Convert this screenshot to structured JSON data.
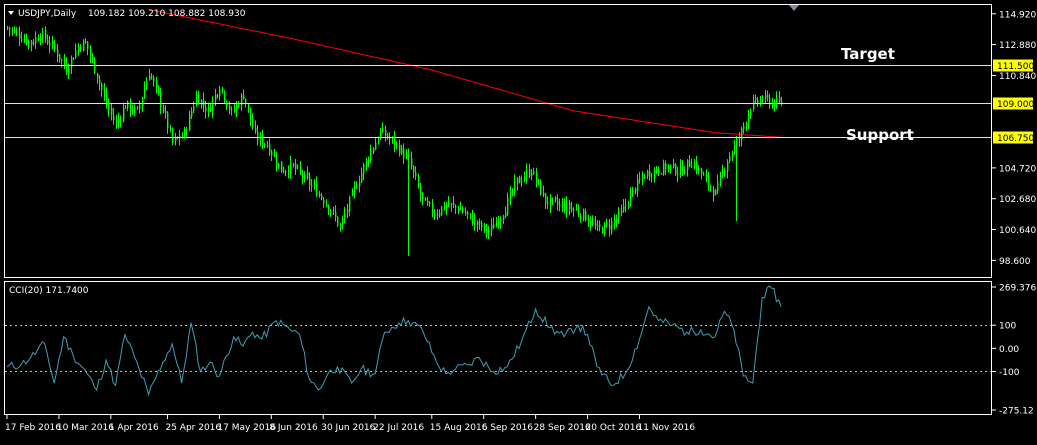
{
  "chart_data": [
    {
      "type": "candlestick",
      "title": "USDJPY,Daily",
      "ohlc_readout": "109.182 109.210 108.882 108.930",
      "ylim": [
        97.5,
        115.5
      ],
      "price_ticks": [
        "114.920",
        "112.880",
        "110.840",
        "104.720",
        "102.680",
        "100.640",
        "98.600"
      ],
      "price_tick_values": [
        114.92,
        112.88,
        110.84,
        104.72,
        102.68,
        100.64,
        98.6
      ],
      "levels": [
        {
          "value": 111.5,
          "label": "111.500",
          "annotation": "Target",
          "color": "#ffff00"
        },
        {
          "value": 109.0,
          "label": "109.000",
          "annotation": "",
          "color": "#ffff00"
        },
        {
          "value": 106.75,
          "label": "106.750",
          "annotation": "Support",
          "color": "#ffff00"
        }
      ],
      "series_color": "#00ff00",
      "ma_color": "#ff0000",
      "ohlc_anchor_days": [
        0,
        4,
        8,
        12,
        16,
        20,
        24,
        27,
        30,
        33,
        36,
        40,
        44,
        48,
        52,
        56,
        60,
        64,
        68,
        72,
        76,
        80,
        84,
        88,
        92,
        96,
        100,
        104,
        108,
        112,
        116,
        120,
        124,
        128,
        132,
        136,
        140,
        144,
        148,
        152,
        156,
        160,
        164,
        168,
        172,
        176,
        180,
        184,
        188,
        192,
        196,
        200,
        204,
        208,
        212,
        216,
        220,
        224,
        228,
        232,
        236,
        240,
        244,
        248,
        252,
        256,
        260,
        264,
        268,
        272,
        274
      ],
      "close_anchors": [
        114.0,
        113.5,
        113.0,
        113.6,
        112.8,
        111.3,
        112.8,
        113.0,
        111.3,
        108.9,
        107.6,
        108.9,
        108.4,
        111.1,
        108.6,
        106.4,
        107.0,
        109.5,
        108.5,
        110.2,
        108.3,
        109.6,
        106.8,
        106.3,
        104.6,
        104.8,
        104.0,
        103.2,
        102.2,
        100.8,
        103.7,
        105.5,
        107.1,
        106.4,
        105.2,
        102.5,
        101.7,
        102.3,
        102.0,
        101.1,
        100.5,
        101.8,
        103.8,
        104.6,
        102.5,
        102.2,
        102.0,
        101.5,
        100.6,
        100.9,
        101.7,
        103.2,
        104.3,
        104.6,
        104.8,
        104.5,
        105.2,
        104.1,
        103.0,
        105.3,
        106.7,
        108.8,
        109.3,
        109.0,
        108.93
      ],
      "close_anchor_days": [
        0,
        5,
        10,
        14,
        19,
        25,
        30,
        33,
        37,
        42,
        46,
        50,
        55,
        60,
        66,
        70,
        75,
        80,
        85,
        90,
        95,
        100,
        105,
        110,
        116,
        121,
        126,
        131,
        136,
        141,
        148,
        153,
        158,
        164,
        170,
        176,
        181,
        186,
        192,
        198,
        204,
        210,
        216,
        222,
        228,
        234,
        240,
        245,
        250,
        255,
        260,
        265,
        270,
        275,
        280,
        285,
        290,
        295,
        300,
        305,
        310,
        315,
        320,
        325,
        328
      ],
      "ma200_anchors": [
        {
          "day": 60,
          "value": 115.2
        },
        {
          "day": 120,
          "value": 113.3
        },
        {
          "day": 180,
          "value": 111.2
        },
        {
          "day": 240,
          "value": 108.5
        },
        {
          "day": 300,
          "value": 107.05
        },
        {
          "day": 328,
          "value": 106.75
        }
      ],
      "low_spikes": [
        {
          "day": 170,
          "value": 98.9
        },
        {
          "day": 309,
          "value": 101.2
        }
      ]
    },
    {
      "type": "line",
      "title": "CCI(20) 171.7400",
      "ylim": [
        -275.12,
        269.38
      ],
      "ticks": [
        "269.3767",
        "100",
        "0.00",
        "-100",
        "-275.12"
      ],
      "tick_values": [
        269.3767,
        100,
        0,
        -100,
        -275.12
      ],
      "dashed_levels": [
        100,
        -100
      ],
      "line_color": "#3ea0b4",
      "x_days": [
        0,
        6,
        10,
        16,
        20,
        24,
        28,
        34,
        38,
        42,
        46,
        50,
        56,
        60,
        66,
        70,
        74,
        78,
        82,
        86,
        90,
        96,
        100,
        104,
        108,
        114,
        120,
        124,
        128,
        132,
        136,
        140,
        146,
        150,
        156,
        160,
        166,
        170,
        176,
        182,
        186,
        190,
        196,
        200,
        206,
        212,
        218,
        224,
        230,
        236,
        242,
        246,
        250,
        256,
        262,
        268,
        272,
        276,
        282,
        288,
        294,
        300,
        304,
        308,
        312,
        316,
        320,
        324,
        328
      ],
      "values": [
        -80,
        -70,
        -40,
        20,
        -150,
        50,
        -30,
        -110,
        -180,
        -50,
        -160,
        60,
        -90,
        -200,
        -60,
        20,
        -150,
        110,
        -100,
        -60,
        -120,
        50,
        10,
        70,
        40,
        120,
        80,
        60,
        -130,
        -180,
        -110,
        -80,
        -150,
        -90,
        -110,
        70,
        110,
        120,
        80,
        -60,
        -110,
        -90,
        -70,
        -40,
        -100,
        -80,
        30,
        170,
        90,
        50,
        100,
        60,
        -80,
        -160,
        -110,
        40,
        180,
        120,
        100,
        70,
        80,
        50,
        160,
        80,
        -120,
        -150,
        220,
        260,
        180
      ]
    }
  ],
  "x_axis": {
    "labels": [
      "17 Feb 2016",
      "10 Mar 2016",
      "1 Apr 2016",
      "25 Apr 2016",
      "17 May 2016",
      "8 Jun 2016",
      "30 Jun 2016",
      "22 Jul 2016",
      "15 Aug 2016",
      "6 Sep 2016",
      "28 Sep 2016",
      "20 Oct 2016",
      "11 Nov 2016"
    ],
    "label_days": [
      0,
      22,
      44,
      68,
      90,
      112,
      134,
      156,
      180,
      202,
      224,
      246,
      268
    ]
  }
}
